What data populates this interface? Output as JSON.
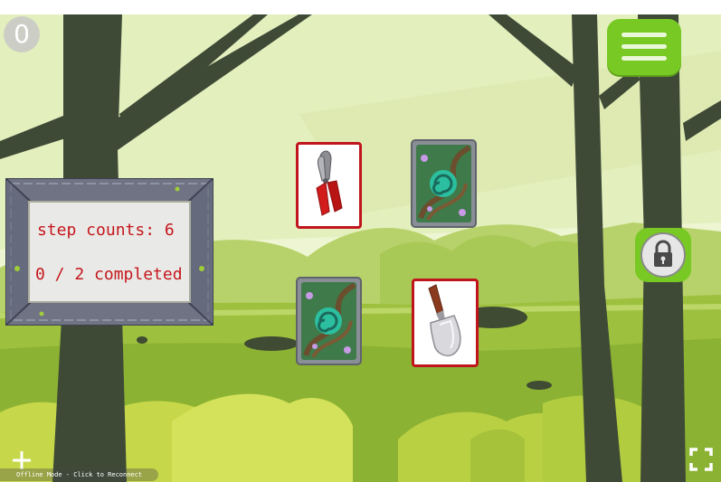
{
  "hud": {
    "score": "0"
  },
  "panel": {
    "step_counts": "step counts: 6",
    "completed": "0 / 2 completed"
  },
  "cards": [
    {
      "name": "card-pruning-shears",
      "state": "face-up",
      "icon": "pruning-shears-icon",
      "selected": true
    },
    {
      "name": "card-back-1",
      "state": "face-down",
      "icon": "card-back-swirl-icon",
      "selected": false
    },
    {
      "name": "card-back-2",
      "state": "face-down",
      "icon": "card-back-swirl-icon",
      "selected": false
    },
    {
      "name": "card-trowel",
      "state": "face-up",
      "icon": "garden-trowel-icon",
      "selected": true
    }
  ],
  "footer": {
    "offline_text": "Offline Mode - Click to Reconnect"
  },
  "colors": {
    "accent_green": "#78c923",
    "selection_red": "#c0151d",
    "text_red": "#c5161d"
  }
}
